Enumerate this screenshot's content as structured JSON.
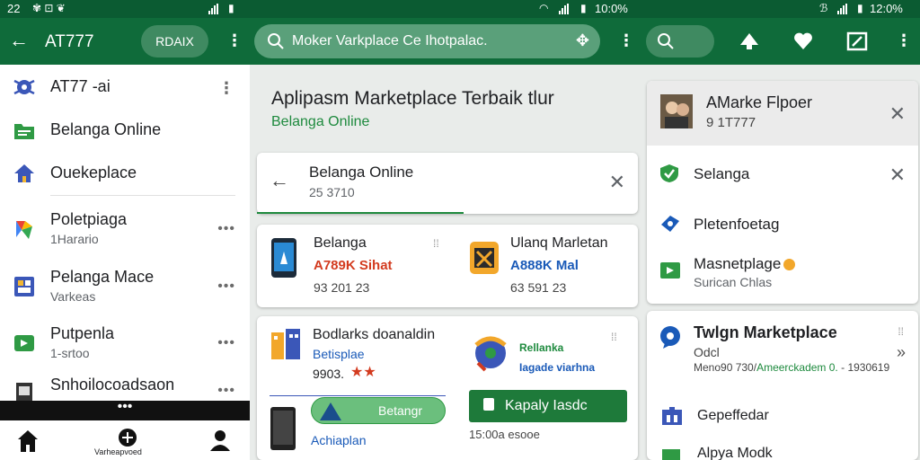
{
  "status": {
    "time_left": "22",
    "time_mid": "10:0%",
    "time_right": "12:0%"
  },
  "appbar": {
    "title": "AT777",
    "button_label": "RDAIX",
    "search_text": "Moker Varkplace Ce Ihotpalac."
  },
  "sidebar": {
    "items": [
      {
        "title": "AT77 -ai",
        "subtitle": ""
      },
      {
        "title": "Belanga Online",
        "subtitle": ""
      },
      {
        "title": "Ouekeplace",
        "subtitle": ""
      },
      {
        "title": "Poletpiaga",
        "subtitle": "1Harario"
      },
      {
        "title": "Pelanga Mace",
        "subtitle": "Varkeas"
      },
      {
        "title": "Putpenla",
        "subtitle": "1-srtoo"
      },
      {
        "title": "Snhoilocoadsaon",
        "subtitle": ""
      }
    ],
    "more": "•••",
    "handle": "•••"
  },
  "bottomnav": {
    "center_label": "Varheapvoed"
  },
  "main": {
    "heading": "Aplipasm Marketplace Terbaik tlur",
    "subheading": "Belanga Online",
    "header_card": {
      "title": "Belanga Online",
      "subtitle": "25 3710"
    },
    "products": [
      {
        "name": "Belanga",
        "price": "A789K Sihat",
        "code": "93 201 23"
      },
      {
        "name": "Ulanq Marletan",
        "price": "A888K Mal",
        "code": "63 591 23"
      }
    ],
    "promo": {
      "title": "Bodlarks doanaldin",
      "subtitle": "Betisplae",
      "rating": "9903.",
      "tag": "Rellanka",
      "tag_sub": "Iagade viarhna",
      "chip_label": "Betangr",
      "cta_label": "Kapaly Iasdc",
      "bottom_text": "Achiaplan",
      "bottom_code": "15:00a  esooe"
    }
  },
  "right": {
    "profile": {
      "title": "AMarke Flpoer",
      "subtitle": "9 1T777"
    },
    "menu": [
      {
        "label": "Selanga"
      },
      {
        "label": "Pletenfoetag"
      },
      {
        "label": "Masnetplage"
      },
      {
        "label": "Surican Chlas"
      }
    ],
    "feature": {
      "title": "Twlgn Marketplace",
      "subtitle": "Odcl",
      "detail": "Meno90 730/",
      "detail_green": "Ameerckadem 0.",
      "detail_end": "- 1930619",
      "items": [
        "Gepeffedar",
        "Alpya Modk"
      ]
    }
  },
  "colors": {
    "primary": "#0f6b3a",
    "accent_green": "#1e8a3e",
    "price_red": "#d33b1f",
    "price_blue": "#1a5ab8"
  }
}
